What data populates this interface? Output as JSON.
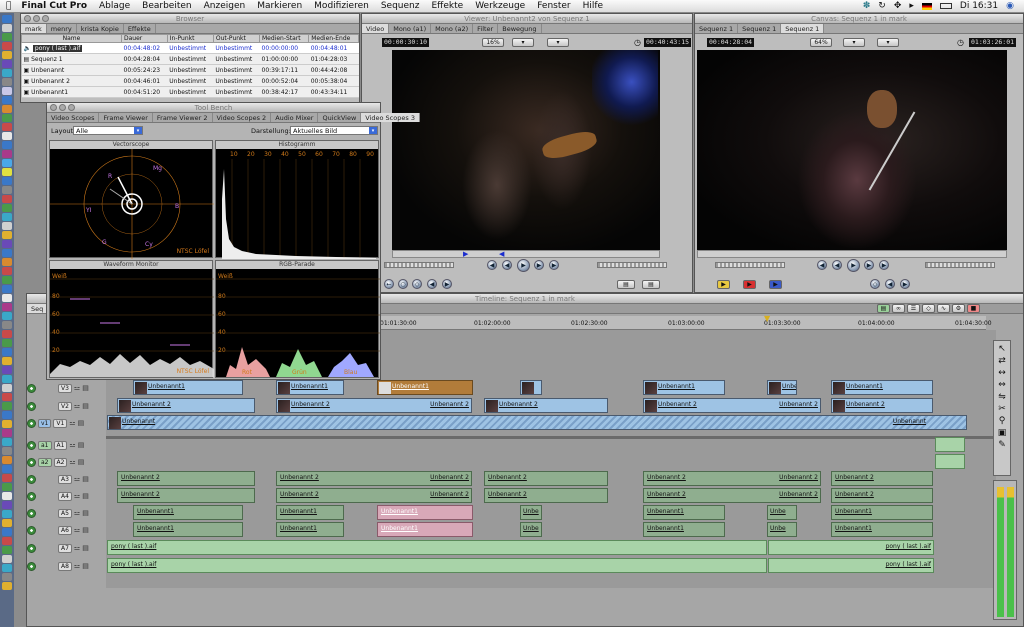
{
  "menubar": {
    "app": "Final Cut Pro",
    "items": [
      "Ablage",
      "Bearbeiten",
      "Anzeigen",
      "Markieren",
      "Modifizieren",
      "Sequenz",
      "Effekte",
      "Werkzeuge",
      "Fenster",
      "Hilfe"
    ],
    "clock": "Di 16:31"
  },
  "browser": {
    "title": "Browser",
    "tabs": [
      "mark",
      "menry",
      "krista Kopie",
      "Effekte"
    ],
    "columns": [
      "Name",
      "Dauer",
      "In-Punkt",
      "Out-Punkt",
      "Medien-Start",
      "Medien-Ende"
    ],
    "rows": [
      [
        "pony ( last ).aif",
        "00:04:48:02",
        "Unbestimmt",
        "Unbestimmt",
        "00:00:00:00",
        "00:04:48:01"
      ],
      [
        "Sequenz 1",
        "00:04:28:04",
        "Unbestimmt",
        "Unbestimmt",
        "01:00:00:00",
        "01:04:28:03"
      ],
      [
        "Unbenannt",
        "00:05:24:23",
        "Unbestimmt",
        "Unbestimmt",
        "00:39:17:11",
        "00:44:42:08"
      ],
      [
        "Unbenannt 2",
        "00:04:46:01",
        "Unbestimmt",
        "Unbestimmt",
        "00:00:52:04",
        "00:05:38:04"
      ],
      [
        "Unbenannt1",
        "00:04:51:20",
        "Unbestimmt",
        "Unbestimmt",
        "00:38:42:17",
        "00:43:34:11"
      ]
    ]
  },
  "viewer": {
    "title": "Viewer: Unbenannt2 von Sequenz 1",
    "tabs": [
      "Video",
      "Mono (a1)",
      "Mono (a2)",
      "Filter",
      "Bewegung"
    ],
    "tc_left": "00:00:30:10",
    "zoom": "16%",
    "tc_right": "00:40:43:15"
  },
  "canvas": {
    "title": "Canvas: Sequenz 1 in mark",
    "tabs": [
      "Sequenz 1",
      "Sequenz 1",
      "Sequenz 1"
    ],
    "tc_left": "00:04:28:04",
    "zoom": "64%",
    "tc_right": "01:03:26:01"
  },
  "toolbench": {
    "title": "Tool Bench",
    "tabs": [
      "Video Scopes",
      "Frame Viewer",
      "Frame Viewer 2",
      "Video Scopes 2",
      "Audio Mixer",
      "QuickView",
      "Video Scopes 3"
    ],
    "layout_label": "Layout:",
    "layout_value": "Alle",
    "display_label": "Darstellung:",
    "display_value": "Aktuelles Bild",
    "scopes": [
      "Vectorscope",
      "Histogramm",
      "Waveform Monitor",
      "RGB-Parade"
    ],
    "ntsc": "NTSC Löfel",
    "histogram_ticks": [
      "10",
      "20",
      "30",
      "40",
      "50",
      "60",
      "70",
      "80",
      "90"
    ],
    "waveform_ticks": [
      "Weiß",
      "80",
      "60",
      "40",
      "20"
    ],
    "parade_ticks": [
      "Weiß",
      "80",
      "60",
      "40",
      "20"
    ],
    "parade_labels": [
      "Rot",
      "Grün",
      "Blau"
    ],
    "vectorscope_labels": [
      "R",
      "Mg",
      "B",
      "Cy",
      "G",
      "YI"
    ]
  },
  "timeline": {
    "title": "Timeline: Sequenz 1 in mark",
    "tab": "Seq",
    "ruler": [
      "01:01:30:00",
      "01:02:00:00",
      "01:02:30:00",
      "01:03:00:00",
      "01:03:30:00",
      "01:04:00:00",
      "01:04:30:00"
    ],
    "tracks": [
      "V3",
      "V2",
      "V1",
      "A1",
      "A2",
      "A3",
      "A4",
      "A5",
      "A6",
      "A7",
      "A8"
    ],
    "patch": [
      "v1",
      "a1",
      "a2"
    ],
    "clip_names": {
      "u1": "Unbenannt1",
      "u2": "Unbenannt 2",
      "u": "Unbenannt",
      "pony": "pony ( last ).aif",
      "uni": "Unbe"
    }
  }
}
